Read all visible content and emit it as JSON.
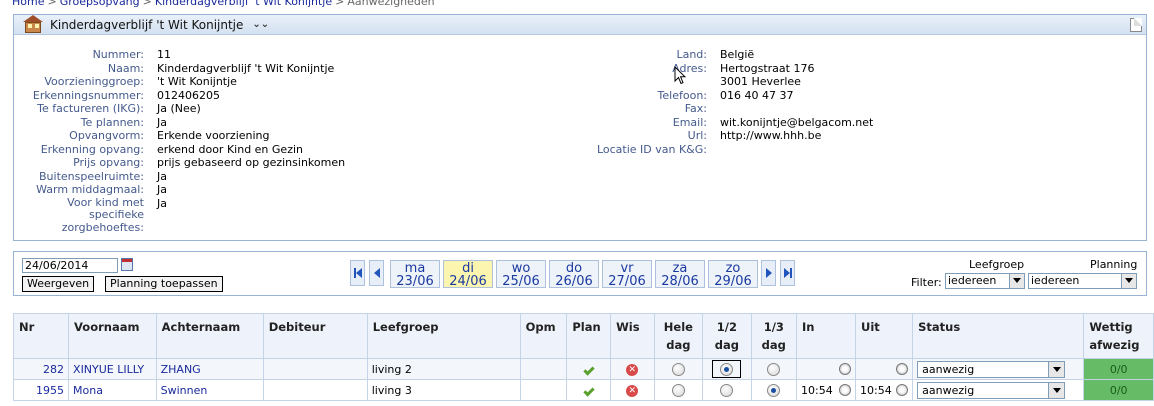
{
  "breadcrumb": {
    "home": "Home",
    "group": "Groepsopvang",
    "facility": "Kinderdagverblijf 't Wit Konijntje",
    "current": "Aanwezigheden"
  },
  "panel": {
    "title": "Kinderdagverblijf 't Wit Konijntje",
    "left": [
      {
        "label": "Nummer:",
        "value": "11"
      },
      {
        "label": "Naam:",
        "value": "Kinderdagverblijf 't Wit Konijntje"
      },
      {
        "label": "Voorzieninggroep:",
        "value": "'t Wit Konijntje"
      },
      {
        "label": "Erkenningsnummer:",
        "value": "012406205"
      },
      {
        "label": "Te factureren (IKG):",
        "value": "Ja (Nee)"
      },
      {
        "label": "Te plannen:",
        "value": "Ja"
      },
      {
        "label": "Opvangvorm:",
        "value": "Erkende voorziening"
      },
      {
        "label": "Erkenning opvang:",
        "value": "erkend door Kind en Gezin"
      },
      {
        "label": "Prijs opvang:",
        "value": "prijs gebaseerd op gezinsinkomen"
      },
      {
        "label": "Buitenspeelruimte:",
        "value": "Ja"
      },
      {
        "label": "Warm middagmaal:",
        "value": "Ja"
      },
      {
        "label": "Voor kind met specifieke zorgbehoeftes:",
        "value": "Ja"
      }
    ],
    "right": [
      {
        "label": "Land:",
        "value": "België"
      },
      {
        "label": "Adres:",
        "value": "Hertogstraat 176"
      },
      {
        "label": "",
        "value": "3001 Heverlee"
      },
      {
        "label": "",
        "value": ""
      },
      {
        "label": "Telefoon:",
        "value": "016 40 47 37"
      },
      {
        "label": "Fax:",
        "value": ""
      },
      {
        "label": "Email:",
        "value": "wit.konijntje@belgacom.net"
      },
      {
        "label": "Url:",
        "value": "http://www.hhh.be"
      },
      {
        "label": "Locatie ID van K&G:",
        "value": ""
      }
    ]
  },
  "toolbar": {
    "date": "24/06/2014",
    "show_label": "Weergeven",
    "apply_label": "Planning toepassen",
    "days": [
      {
        "dow": "ma",
        "date": "23/06"
      },
      {
        "dow": "di",
        "date": "24/06"
      },
      {
        "dow": "wo",
        "date": "25/06"
      },
      {
        "dow": "do",
        "date": "26/06"
      },
      {
        "dow": "vr",
        "date": "27/06"
      },
      {
        "dow": "za",
        "date": "28/06"
      },
      {
        "dow": "zo",
        "date": "29/06"
      }
    ],
    "selected_day": "di",
    "leefgroep_label": "Leefgroep",
    "planning_label": "Planning",
    "filter_label": "Filter:",
    "leefgroep_value": "iedereen",
    "planning_value": "iedereen"
  },
  "table": {
    "headers": [
      "Nr",
      "Voornaam",
      "Achternaam",
      "Debiteur",
      "Leefgroep",
      "Opm",
      "Plan",
      "Wis",
      "Hele dag",
      "1/2 dag",
      "1/3 dag",
      "In",
      "Uit",
      "Status",
      "Wettig afwezig"
    ],
    "rows": [
      {
        "nr": "282",
        "voornaam": "XINYUE LILLY",
        "achternaam": "ZHANG",
        "debiteur": "",
        "leefgroep": "living 2",
        "opm": "",
        "in": "",
        "uit": "",
        "status": "aanwezig",
        "wettig": "0/0",
        "selected": "1/2 dag"
      },
      {
        "nr": "1955",
        "voornaam": "Mona",
        "achternaam": "Swinnen",
        "debiteur": "",
        "leefgroep": "living 3",
        "opm": "",
        "in": "10:54",
        "uit": "10:54",
        "status": "aanwezig",
        "wettig": "0/0",
        "selected": "1/3 dag"
      }
    ]
  }
}
